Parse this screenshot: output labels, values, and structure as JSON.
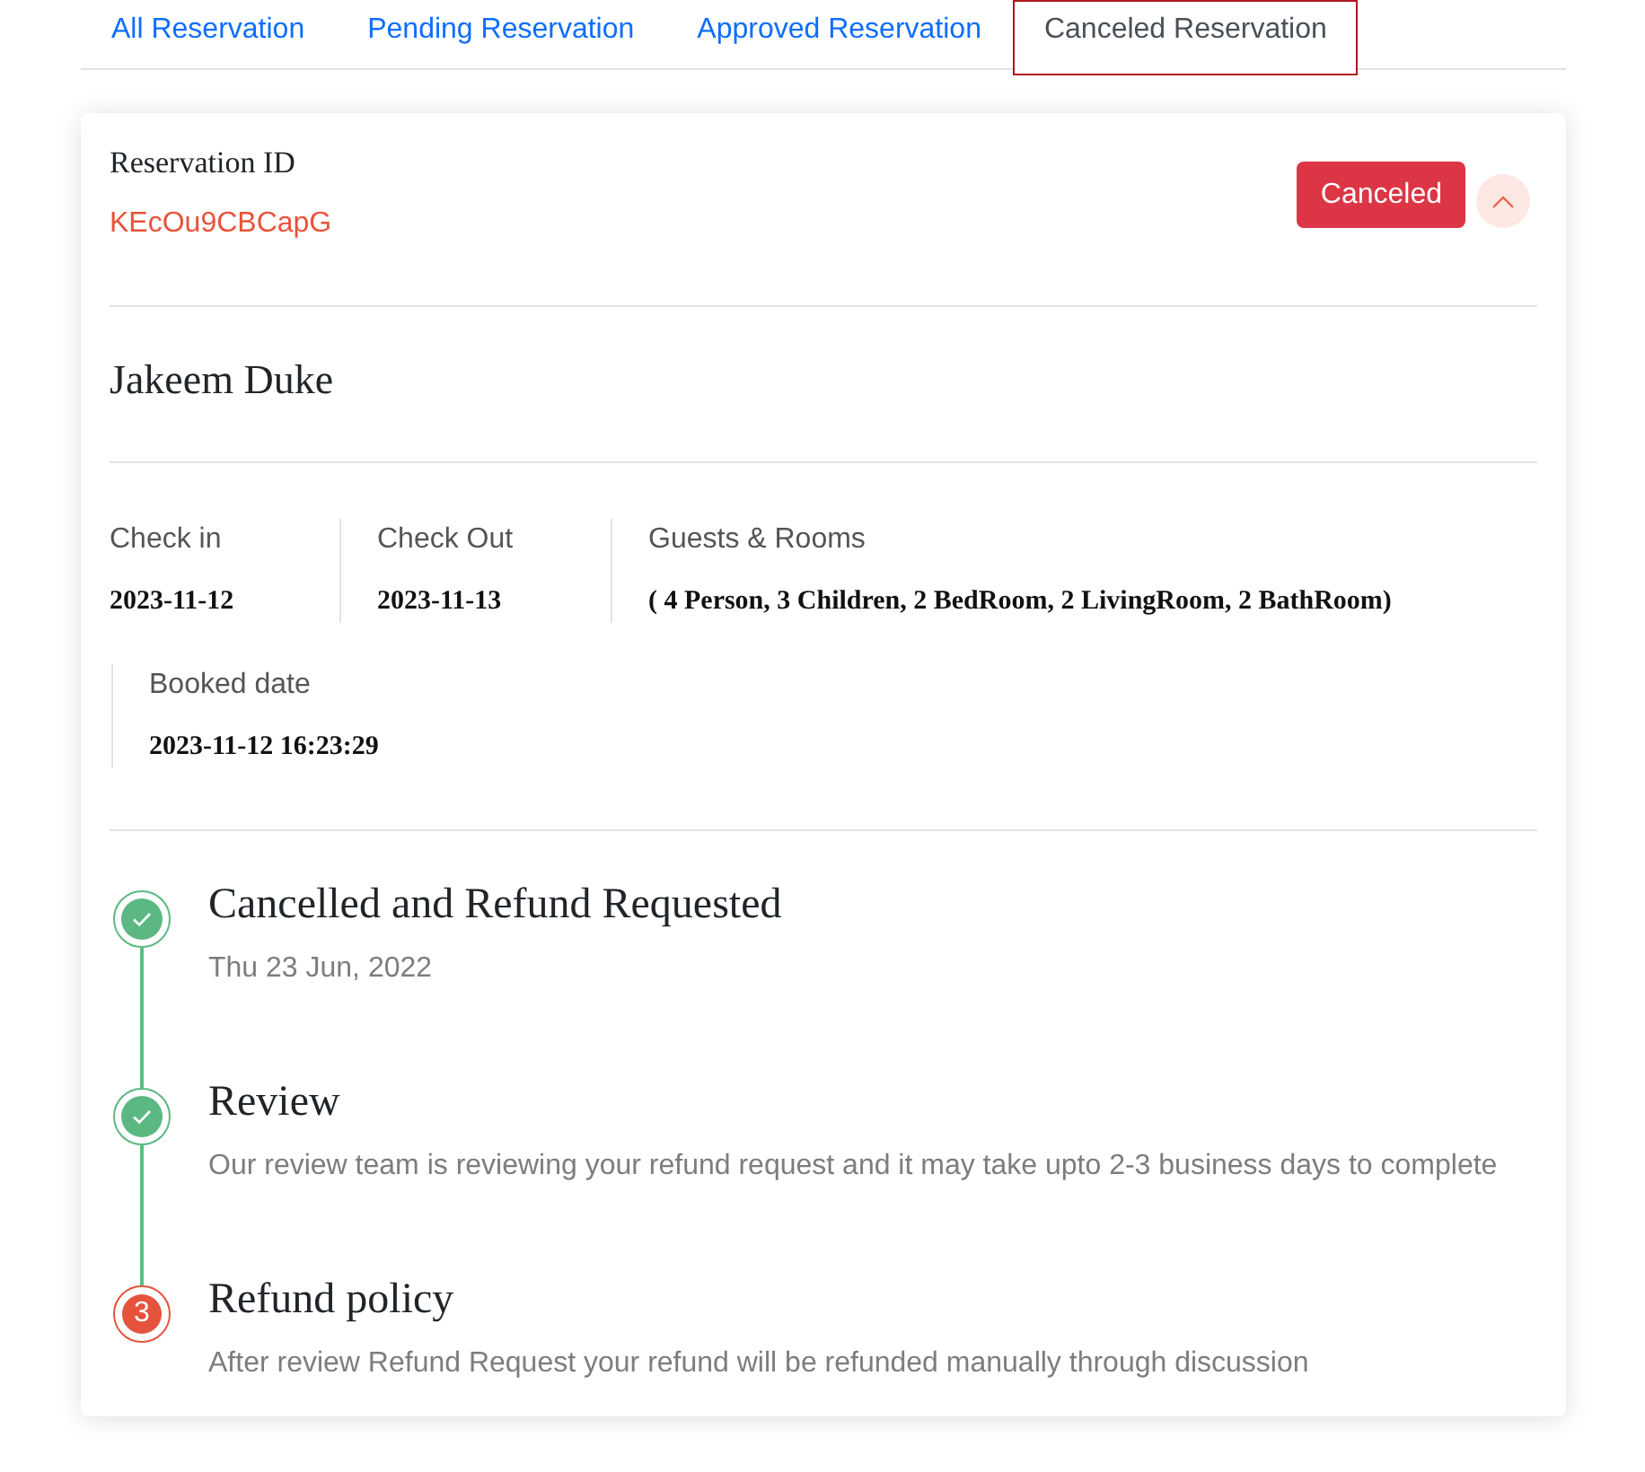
{
  "tabs": [
    {
      "label": "All Reservation",
      "selected": false
    },
    {
      "label": "Pending Reservation",
      "selected": false
    },
    {
      "label": "Approved Reservation",
      "selected": false
    },
    {
      "label": "Canceled Reservation",
      "selected": true
    }
  ],
  "reservation": {
    "id_label": "Reservation ID",
    "id": "KEcOu9CBCapG",
    "status": "Canceled",
    "expanded": true,
    "guest_name": "Jakeem Duke",
    "details": [
      {
        "label": "Check in",
        "value": "2023-11-12"
      },
      {
        "label": "Check Out",
        "value": "2023-11-13"
      },
      {
        "label": "Guests & Rooms",
        "value": "( 4 Person, 3 Children, 2 BedRoom, 2 LivingRoom, 2 BathRoom)"
      }
    ],
    "booked": {
      "label": "Booked date",
      "value": "2023-11-12 16:23:29"
    },
    "timeline": [
      {
        "kind": "done",
        "title": "Cancelled and Refund Requested",
        "text": "Thu 23 Jun, 2022"
      },
      {
        "kind": "done",
        "title": "Review",
        "text": "Our review team is reviewing your refund request and it may take upto 2-3 business days to complete"
      },
      {
        "kind": "current",
        "step": "3",
        "title": "Refund policy",
        "text": "After review Refund Request your refund will be refunded manually through discussion"
      }
    ]
  }
}
